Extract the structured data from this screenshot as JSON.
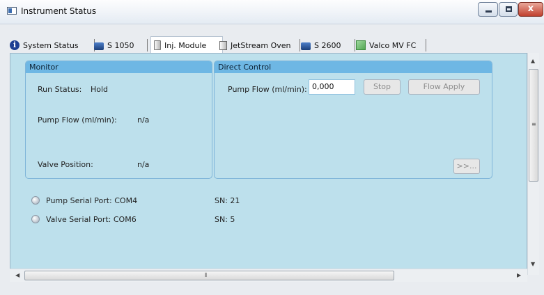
{
  "window": {
    "title": "Instrument Status",
    "icon": "window-icon"
  },
  "window_controls": {
    "minimize": "minimize-icon",
    "maximize": "maximize-icon",
    "close": "x"
  },
  "tabs": [
    {
      "label": "System Status",
      "icon": "info-icon"
    },
    {
      "label": "S 1050",
      "icon": "device-icon"
    },
    {
      "label": "Inj. Module",
      "icon": "column-icon",
      "active": true
    },
    {
      "label": "JetStream Oven",
      "icon": "oven-icon"
    },
    {
      "label": "S 2600",
      "icon": "device-icon"
    },
    {
      "label": "Valco MV FC",
      "icon": "valco-icon"
    }
  ],
  "monitor": {
    "title": "Monitor",
    "run_status_label": "Run Status:",
    "run_status_value": "Hold",
    "pump_flow_label": "Pump Flow (ml/min):",
    "pump_flow_value": "n/a",
    "valve_position_label": "Valve Position:",
    "valve_position_value": "n/a"
  },
  "direct_control": {
    "title": "Direct Control",
    "pump_flow_label": "Pump Flow (ml/min):",
    "pump_flow_value": "0,000",
    "stop_label": "Stop",
    "flow_apply_label": "Flow Apply",
    "more_label": ">>..."
  },
  "ports": [
    {
      "label": "Pump Serial Port: COM4",
      "sn": "SN:  21"
    },
    {
      "label": "Valve Serial Port: COM6",
      "sn": "SN:  5"
    }
  ],
  "scrollbars": {
    "grip_vertical": "≡",
    "grip_horizontal": "⦀"
  }
}
